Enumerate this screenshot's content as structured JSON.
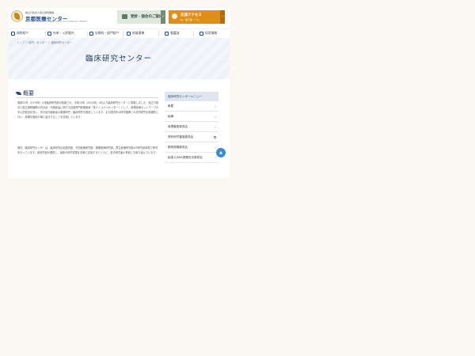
{
  "header": {
    "org_sub": "独立行政法人国立病院機構",
    "org_name": "京都医療センター",
    "org_en": "NATIONAL HOSPITAL ORGANIZATION KYOTO MEDICAL CENTER",
    "hospital_btn_label": "受診・面会のご案内",
    "access_btn_line1": "交通アクセス",
    "access_btn_line2": "JR・地下鉄・バス",
    "arrow": "›"
  },
  "nav": [
    {
      "label": "病院紹介"
    },
    {
      "label": "外来・入院案内"
    },
    {
      "label": "診療科・部門紹介"
    },
    {
      "label": "地域連携"
    },
    {
      "label": "看護部"
    },
    {
      "label": "採用情報"
    }
  ],
  "breadcrumb": "トップ ＞ 部門・センター ＞ 臨床研究センター",
  "page_title": "臨床研究センター",
  "section_heading": "概要",
  "paragraphs": [
    "昭和55年（1979年）4月臨床研究部が設置され、平成15年（2003年）4月より臨床研究センターに昇格しました。独立行政法人国立病院機構の内分泌・代謝疾患に関する高度専門医療施設（準ナショナルセンター）として、政策医療ネットワークの中心的役割を担い、内分泌代謝疾患の基礎研究・臨床研究を推進しています。また国内外の研究機関との共同研究を積極的に行い、成果を臨床の場に還元することを目指しています。",
    "現在、臨床研究センターは、臨床研究企画運営部、予防医療研究部、展開医療研究部、再生医療研究部の5研究部体制で研究を行っています。各研究部が連携し、最新の研究成果を診療に応用するとともに、若手研究者の育成にも取り組んでいます。"
  ],
  "sidebar": {
    "title": "臨床研究センターメニュー",
    "items": [
      {
        "label": "概要",
        "arrow": "›"
      },
      {
        "label": "組織",
        "arrow": "›"
      },
      {
        "label": "倫理審査委員会",
        "arrow": "›"
      },
      {
        "label": "受託研究審査委員会",
        "arrow": "⧉"
      },
      {
        "label": "動物実験委員会",
        "arrow": "›"
      },
      {
        "label": "組換えDNA実験安全委員会",
        "arrow": "›"
      }
    ]
  },
  "scroll_top_label": "▲"
}
